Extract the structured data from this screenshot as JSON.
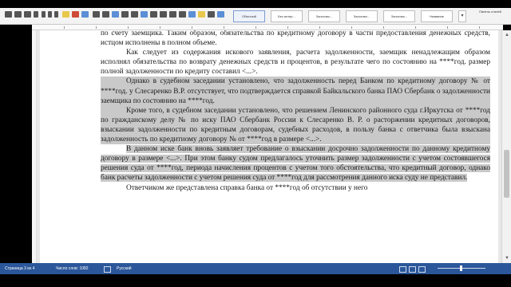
{
  "ribbon": {
    "styles": [
      "Обычный",
      "Без интер...",
      "Заголово...",
      "Заголово...",
      "Заголово...",
      "Название"
    ],
    "styles_pane_label": "Панель стилей"
  },
  "document": {
    "paragraphs": [
      "по счету заемщика. Таким образом, обязательства по кредитному договору в части предоставления денежных средств, истцом исполнены в полном объеме.",
      "Как следует из содержания искового заявления, расчета задолженности, заемщик ненадлежащим образом исполнял обязательства по возврату денежных средств и процентов, в результате чего по состоянию на ****год. размер полной задолженности по кредиту составил <...>.",
      "Однако в судебном заседании установлено, что задолженность перед Банком по кредитному договору № от ****год. у Слесаренко В.Р. отсутствует, что подтверждается справкой Байкальского банка ПАО Сбербанк о задолженности заемщика по состоянию на ****год.",
      "Кроме того, в судебном заседании установлено, что решением Ленинского районного суда г.Иркутска от ****год по гражданскому делу № по иску ПАО Сбербанк России к Слесаренко В. Р. о расторжении кредитных договоров, взыскании задолженности по кредитным договорам, судебных расходов, в пользу банка с ответчика была взыскана задолженность по кредитному договору № от ****год в размере <...>.",
      "В данном иске банк вновь заявляет требование о взыскании досрочно задолженности по данному кредитному договору в размере <...>. При этом банку судом предлагалось уточнить размер задолженности с учетом состоявшегося решения суда от ****год, периода начисления процентов с учетом того обстоятельства, что кредитный договор, однако банк расчеты задолженности с учетом решения суда от ****год для рассмотрения данного иска суду не представил.",
      "Ответчиком же представлена справка банка от ****год об отсутствии у него"
    ]
  },
  "status_bar": {
    "page": "Страница 3 из 4",
    "words": "Число слов: 1082",
    "language": "Русский"
  },
  "colors": {
    "status_bar": "#2b579a",
    "highlight": "#c9c9c9",
    "ribbon": "#f3f3f3"
  }
}
